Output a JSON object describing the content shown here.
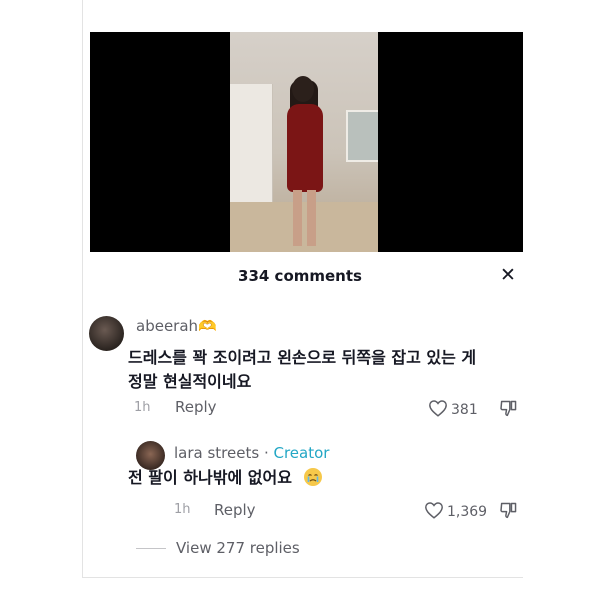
{
  "video": {
    "background": "#000000"
  },
  "header": {
    "comment_count": "334 comments",
    "close_label": "✕"
  },
  "comments": [
    {
      "username": "abeerah🫶",
      "text_line1": "드레스를 꽉 조이려고 왼손으로 뒤쪽을 잡고 있는 게",
      "text_line2": "정말 현실적이네요",
      "time": "1h",
      "reply_label": "Reply",
      "likes": "381"
    }
  ],
  "reply": {
    "username": "lara streets",
    "separator": " · ",
    "creator_label": "Creator",
    "text": "전 팔이 하나밖에 없어요",
    "time": "1h",
    "reply_label": "Reply",
    "likes": "1,369"
  },
  "view_replies": "View 277 replies",
  "colors": {
    "accent_creator": "#23a7c5",
    "text_primary": "#161823",
    "text_secondary": "#5e5f66"
  }
}
